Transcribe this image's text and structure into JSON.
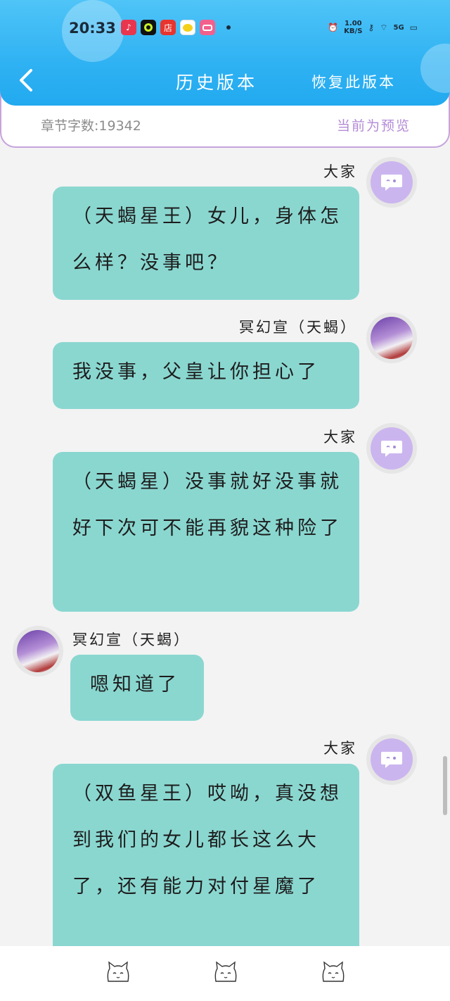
{
  "status_bar": {
    "time": "20:33",
    "net_speed_value": "1.00",
    "net_speed_unit": "KB/S",
    "network": "5G",
    "app_store_label": "店"
  },
  "header": {
    "title": "历史版本",
    "restore_button": "恢复此版本"
  },
  "info": {
    "word_count": "章节字数:19342",
    "preview_note": "当前为预览"
  },
  "messages": [
    {
      "sender": "大家",
      "text": "（天蝎星王）女儿，身体怎么样？没事吧？"
    },
    {
      "sender": "冥幻宣（天蝎）",
      "text": "我没事，父皇让你担心了"
    },
    {
      "sender": "大家",
      "text": "（天蝎星）没事就好没事就好下次可不能再貌这种险了"
    },
    {
      "sender": "冥幻宣（天蝎）",
      "text": "嗯知道了"
    },
    {
      "sender": "大家",
      "text": "（双鱼星王）哎呦，真没想到我们的女儿都长这么大了，还有能力对付星魔了"
    }
  ],
  "colors": {
    "header_blue": "#2fb2f3",
    "bubble_teal": "#8ad7d0",
    "accent_purple": "#b38ad6"
  },
  "icons": {
    "back": "chevron-left-icon",
    "system_avatar": "chat-bubble-icon",
    "bottom_nav": [
      "cat-face-icon",
      "cat-face-icon",
      "cat-face-icon"
    ]
  }
}
